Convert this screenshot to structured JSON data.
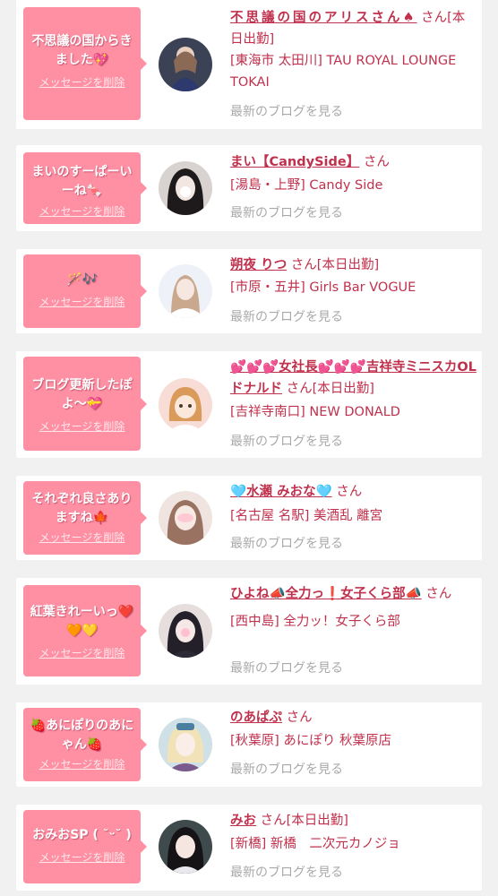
{
  "feed": {
    "delete_label": "メッセージを削除",
    "blog_label": "最新のブログを見る",
    "items": [
      {
        "message": "不思議の国からきました💖",
        "name": "不思議の国のアリスさん♠",
        "suffix": " さん[本日出勤]",
        "shop": "[東海市 太田川] TAU ROYAL LOUNGE TOKAI"
      },
      {
        "message": "まいのすーぱーいーね🍬",
        "name": "まい【CandySide】",
        "suffix": " さん",
        "shop": "[湯島・上野] Candy Side"
      },
      {
        "message": "🪄🎶",
        "name": "朔夜 りつ",
        "suffix": " さん[本日出勤]",
        "shop": "[市原・五井] Girls Bar VOGUE"
      },
      {
        "message": "ブログ更新したぽよ〜💝",
        "name": "💕💕💕女社長💕💕💕吉祥寺ミニスカOLドナルド",
        "suffix": " さん[本日出勤]",
        "shop": "[吉祥寺南口] NEW DONALD"
      },
      {
        "message": "それぞれ良さありますね🍁",
        "name": "🩵水瀬 みおな🩵",
        "suffix": " さん",
        "shop": "[名古屋 名駅] 美酒乱 離宮"
      },
      {
        "message": "紅葉きれーいっ❤️🧡💛",
        "name": "ひよね📣全力っ❗女子くら部📣",
        "suffix": " さん",
        "shop": "[西中島] 全力ッ！女子くら部"
      },
      {
        "message": "🍓あにぽりのあにゃん🍓",
        "name": "のあぱぷ",
        "suffix": " さん",
        "shop": "[秋葉原] あにぽり 秋葉原店"
      },
      {
        "message": "おみおSP ( ˘ᵕ˘ )",
        "name": "みお",
        "suffix": " さん[本日出勤]",
        "shop": "[新橋] 新橋　二次元カノジョ"
      }
    ]
  },
  "colors": {
    "bubble": "#ff8fa3",
    "accent": "#c0314d",
    "muted": "#a9a9a9",
    "background": "#f1f1f1"
  }
}
